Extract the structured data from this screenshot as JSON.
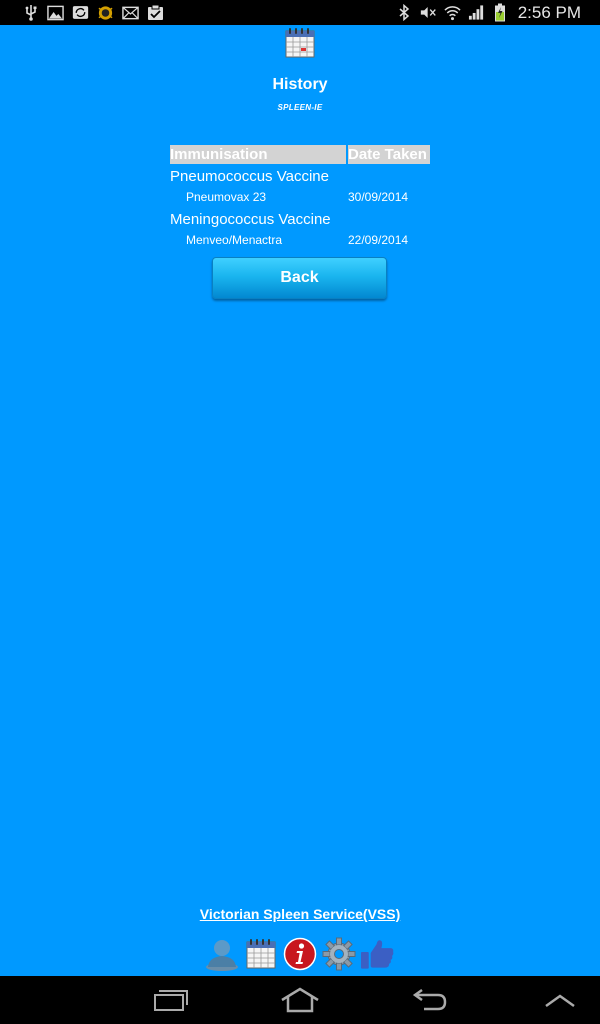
{
  "status_bar": {
    "time": "2:56 PM",
    "left_icons": [
      "usb-icon",
      "image-icon",
      "sync-icon",
      "bug-icon",
      "mail-icon",
      "clipboard-check-icon"
    ],
    "right_icons": [
      "bluetooth-icon",
      "mute-icon",
      "wifi-icon",
      "signal-icon",
      "battery-icon"
    ]
  },
  "header": {
    "icon": "calendar-icon",
    "title": "History",
    "subtitle": "SPLEEN-IE"
  },
  "table": {
    "headers": [
      "Immunisation",
      "Date Taken"
    ],
    "rows": [
      {
        "vaccine": "Pneumococcus Vaccine",
        "brand": "Pneumovax 23",
        "date": "30/09/2014"
      },
      {
        "vaccine": "Meningococcus Vaccine",
        "brand": "Menveo/Menactra",
        "date": "22/09/2014"
      }
    ]
  },
  "back_button": {
    "label": "Back"
  },
  "footer": {
    "link": "Victorian Spleen Service(VSS)",
    "icons": [
      "profile-icon",
      "calendar-icon",
      "info-icon",
      "settings-icon",
      "thumbs-up-icon"
    ]
  },
  "nav_bar": {
    "icons": [
      "recent-apps-icon",
      "home-icon",
      "back-arrow-icon",
      "collapse-up-icon"
    ]
  },
  "colors": {
    "background": "#0099ff",
    "header_cell": "#d3d3d3",
    "button_top": "#3fd0ff",
    "button_bottom": "#0288d1"
  }
}
